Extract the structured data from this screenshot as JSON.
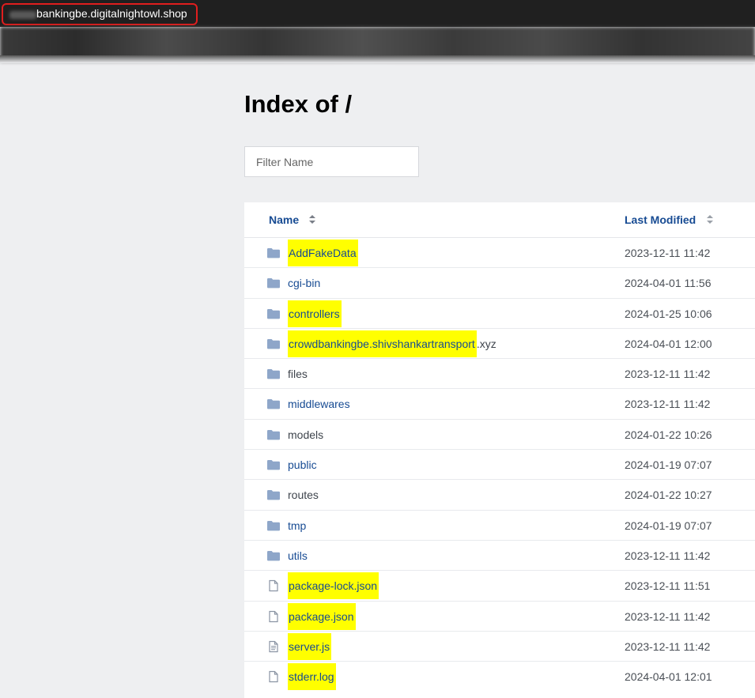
{
  "browser": {
    "url": "bankingbe.digitalnightowl.shop"
  },
  "page": {
    "title": "Index of /",
    "filter_placeholder": "Filter Name"
  },
  "table": {
    "headers": {
      "name": "Name",
      "last_modified": "Last Modified"
    },
    "rows": [
      {
        "name": "AddFakeData",
        "suffix": "",
        "type": "folder",
        "date": "2023-12-11 11:42",
        "highlighted": true,
        "link": true
      },
      {
        "name": "cgi-bin",
        "suffix": "",
        "type": "folder",
        "date": "2024-04-01 11:56",
        "highlighted": false,
        "link": true
      },
      {
        "name": "controllers",
        "suffix": "",
        "type": "folder",
        "date": "2024-01-25 10:06",
        "highlighted": true,
        "link": true
      },
      {
        "name": "crowdbankingbe.shivshankartransport",
        "suffix": ".xyz",
        "type": "folder",
        "date": "2024-04-01 12:00",
        "highlighted": true,
        "link": true
      },
      {
        "name": "files",
        "suffix": "",
        "type": "folder",
        "date": "2023-12-11 11:42",
        "highlighted": false,
        "link": false
      },
      {
        "name": "middlewares",
        "suffix": "",
        "type": "folder",
        "date": "2023-12-11 11:42",
        "highlighted": false,
        "link": true
      },
      {
        "name": "models",
        "suffix": "",
        "type": "folder",
        "date": "2024-01-22 10:26",
        "highlighted": false,
        "link": false
      },
      {
        "name": "public",
        "suffix": "",
        "type": "folder",
        "date": "2024-01-19 07:07",
        "highlighted": false,
        "link": true
      },
      {
        "name": "routes",
        "suffix": "",
        "type": "folder",
        "date": "2024-01-22 10:27",
        "highlighted": false,
        "link": false
      },
      {
        "name": "tmp",
        "suffix": "",
        "type": "folder",
        "date": "2024-01-19 07:07",
        "highlighted": false,
        "link": true
      },
      {
        "name": "utils",
        "suffix": "",
        "type": "folder",
        "date": "2023-12-11 11:42",
        "highlighted": false,
        "link": true
      },
      {
        "name": "package-lock.json",
        "suffix": "",
        "type": "file",
        "date": "2023-12-11 11:51",
        "highlighted": true,
        "link": true
      },
      {
        "name": "package.json",
        "suffix": "",
        "type": "file",
        "date": "2023-12-11 11:42",
        "highlighted": true,
        "link": true
      },
      {
        "name": "server.js",
        "suffix": "",
        "type": "file-text",
        "date": "2023-12-11 11:42",
        "highlighted": true,
        "link": true
      },
      {
        "name": "stderr.log",
        "suffix": "",
        "type": "file",
        "date": "2024-04-01 12:01",
        "highlighted": true,
        "link": true
      }
    ]
  },
  "colors": {
    "link": "#174b93",
    "highlight": "#ffff00",
    "folder_icon": "#8ea6c9",
    "url_box_border": "#e01e1e"
  },
  "icons": {
    "folder": "folder-icon",
    "file": "file-icon",
    "file-text": "file-text-icon"
  }
}
